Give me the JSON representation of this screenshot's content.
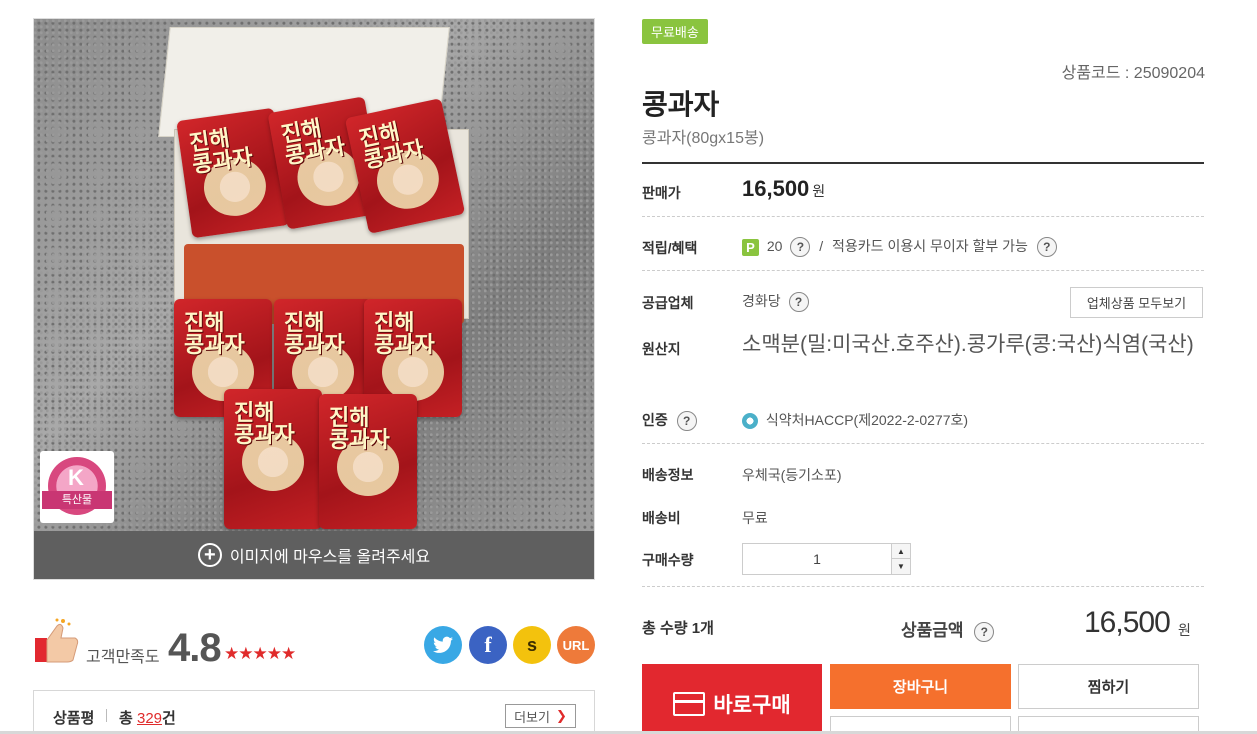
{
  "image": {
    "hover_hint": "이미지에 마우스를 올려주세요",
    "bag_text": "진해\n콩과자",
    "badge_text": "특산물",
    "badge_letter": "K"
  },
  "satisfaction": {
    "label": "고객만족도",
    "score": "4.8",
    "stars": "★★★★★",
    "share": {
      "twitter": "t",
      "facebook": "f",
      "kakao": "s",
      "url": "URL"
    }
  },
  "review": {
    "title": "상품평",
    "total_prefix": "총",
    "count": "329",
    "total_suffix": "건",
    "more_label": "더보기",
    "more_chevron": "❯"
  },
  "product": {
    "free_shipping": "무료배송",
    "code": "상품코드 : 25090204",
    "title": "콩과자",
    "subtitle": "콩과자(80gx15봉)"
  },
  "rows": {
    "price_label": "판매가",
    "price": "16,500",
    "currency": "원",
    "benefit_label": "적립/혜택",
    "point_icon": "P",
    "points": "20",
    "benefit_sep": "/",
    "benefit_text": "적용카드 이용시 무이자 할부 가능",
    "supplier_label": "공급업체",
    "supplier": "경화당",
    "supplier_button": "업체상품 모두보기",
    "origin_label": "원산지",
    "origin": "소맥분(밀:미국산.호주산).콩가루(콩:국산)식염(국산)",
    "cert_label": "인증",
    "cert": "식약처HACCP(제2022-2-0277호)",
    "delivery_label": "배송정보",
    "delivery": "우체국(등기소포)",
    "fee_label": "배송비",
    "fee": "무료",
    "qty_label": "구매수량",
    "qty": "1",
    "help": "?"
  },
  "total": {
    "count_label": "총 수량 1개",
    "amount_label": "상품금액",
    "amount": "16,500",
    "currency": "원"
  },
  "buttons": {
    "buy": "바로구매",
    "cart": "장바구니",
    "wish": "찜하기"
  },
  "colors": {
    "accent_red": "#e2282f",
    "orange": "#f5702d",
    "green_badge": "#8ac43f"
  }
}
